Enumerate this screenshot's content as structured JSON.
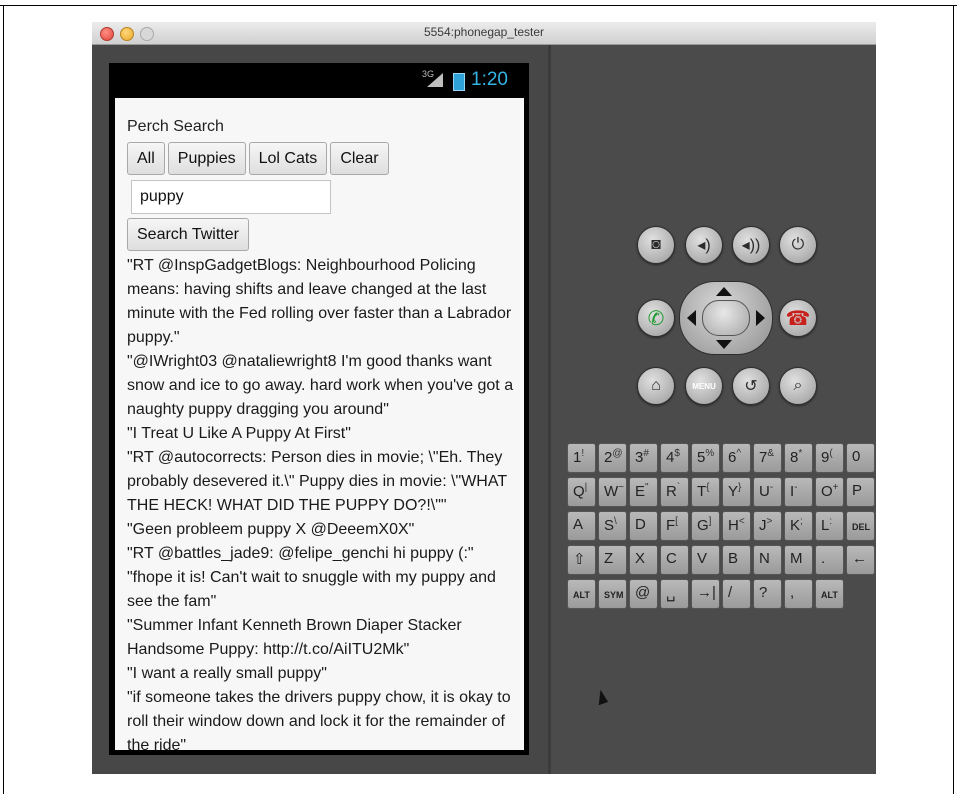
{
  "window": {
    "title": "5554:phonegap_tester"
  },
  "statusbar": {
    "network": "3G",
    "time": "1:20",
    "battery_color": "#2fa3d8",
    "time_color": "#33b5e5"
  },
  "app": {
    "title": "Perch Search",
    "buttons": [
      {
        "label": "All"
      },
      {
        "label": "Puppies"
      },
      {
        "label": "Lol Cats"
      },
      {
        "label": "Clear"
      }
    ],
    "search": {
      "value": "puppy"
    },
    "search_button": "Search Twitter",
    "tweets": [
      "\"RT @InspGadgetBlogs: Neighbourhood Policing means: having shifts and leave changed at the last minute with the Fed rolling over faster than a Labrador puppy.\"",
      "\"@IWright03 @nataliewright8 I'm good thanks want snow and ice to go away. hard work when you've got a naughty puppy dragging you around\"",
      "\"I Treat U Like A Puppy At First\"",
      "\"RT @autocorrects: Person dies in movie; \\\"Eh. They probably desevered it.\\\" Puppy dies in movie: \\\"WHAT THE HECK! WHAT DID THE PUPPY DO?!\\\"\"",
      "\"Geen probleem puppy X @DeeemX0X\"",
      "\"RT @battles_jade9: @felipe_genchi hi puppy (:\"",
      "\"fhope it is! Can't wait to snuggle with my puppy and see the fam\"",
      "\"Summer Infant Kenneth Brown Diaper Stacker Handsome Puppy: http://t.co/AiITU2Mk\"",
      "\"I want a really small puppy\"",
      "\"if someone takes the drivers puppy chow, it is okay to roll their window down and lock it for the remainder of the ride\""
    ]
  },
  "controls": {
    "menu_label": "MENU",
    "icons": [
      "camera-icon",
      "volume-down-icon",
      "volume-up-icon",
      "power-icon",
      "call-icon",
      "end-call-icon",
      "home-icon",
      "menu-icon",
      "back-icon",
      "search-icon"
    ]
  },
  "keyboard": {
    "row1": [
      {
        "k": "1",
        "s": "!"
      },
      {
        "k": "2",
        "s": "@"
      },
      {
        "k": "3",
        "s": "#"
      },
      {
        "k": "4",
        "s": "$"
      },
      {
        "k": "5",
        "s": "%"
      },
      {
        "k": "6",
        "s": "^"
      },
      {
        "k": "7",
        "s": "&"
      },
      {
        "k": "8",
        "s": "*"
      },
      {
        "k": "9",
        "s": "("
      },
      {
        "k": "0",
        "s": ""
      }
    ],
    "row2": [
      {
        "k": "Q",
        "s": "|"
      },
      {
        "k": "W",
        "s": "~"
      },
      {
        "k": "E",
        "s": "\""
      },
      {
        "k": "R",
        "s": "`"
      },
      {
        "k": "T",
        "s": "{"
      },
      {
        "k": "Y",
        "s": "}"
      },
      {
        "k": "U",
        "s": "-"
      },
      {
        "k": "I",
        "s": "-"
      },
      {
        "k": "O",
        "s": "+"
      },
      {
        "k": "P",
        "s": ""
      }
    ],
    "row3": [
      {
        "k": "A",
        "s": ""
      },
      {
        "k": "S",
        "s": "\\"
      },
      {
        "k": "D",
        "s": ""
      },
      {
        "k": "F",
        "s": "["
      },
      {
        "k": "G",
        "s": "]"
      },
      {
        "k": "H",
        "s": "<"
      },
      {
        "k": "J",
        "s": ">"
      },
      {
        "k": "K",
        "s": ";"
      },
      {
        "k": "L",
        "s": ":"
      },
      {
        "k": "DEL",
        "s": ""
      }
    ],
    "row4": [
      "⇧",
      "Z",
      "X",
      "C",
      "V",
      "B",
      "N",
      "M",
      ".",
      "←"
    ],
    "row5": [
      "ALT",
      "SYM",
      "@",
      "␣",
      "→|",
      "/",
      "?",
      ",",
      "ALT"
    ]
  }
}
